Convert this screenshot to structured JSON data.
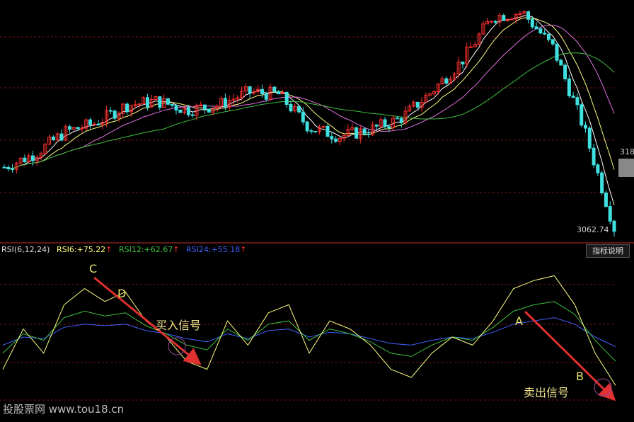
{
  "indicator": {
    "name": "RSI(6,12,24)",
    "rsi6_label": "RSI6:",
    "rsi6_value": "+75.22",
    "rsi12_label": "RSI12:",
    "rsi12_value": "+62.67",
    "rsi24_label": "RSI24:",
    "rsi24_value": "+55.18",
    "arrow": "↑"
  },
  "explain_button": "指标说明",
  "price_labels": {
    "top_right": "318",
    "low": "3062.74"
  },
  "annotations": {
    "C": "C",
    "D": "D",
    "A": "A",
    "B": "B",
    "buy": "买入信号",
    "sell": "卖出信号"
  },
  "watermark": "投股票网 www.tou18.cn",
  "colors": {
    "bg": "#000000",
    "up": "#ff3030",
    "down": "#40e0e0",
    "ma_white": "#ffffff",
    "ma_yellow": "#ffff80",
    "ma_magenta": "#e070e0",
    "ma_green": "#40c040",
    "rsi6": "#ffff80",
    "rsi12": "#40c040",
    "rsi24": "#4060ff",
    "signal_arrow": "#e03030"
  },
  "chart_data": [
    {
      "type": "candlestick",
      "title": "",
      "series": [
        {
          "name": "price",
          "close_trend": [
            3200,
            3230,
            3280,
            3300,
            3340,
            3350,
            3330,
            3340,
            3370,
            3365,
            3290,
            3270,
            3285,
            3310,
            3370,
            3440,
            3540,
            3550,
            3470,
            3290,
            3062.74
          ]
        }
      ]
    },
    {
      "type": "line",
      "title": "RSI(6,12,24)",
      "series": [
        {
          "name": "RSI6",
          "last": 75.22,
          "values": [
            30,
            55,
            40,
            70,
            80,
            72,
            78,
            60,
            50,
            35,
            30,
            60,
            45,
            65,
            70,
            40,
            60,
            55,
            45,
            30,
            25,
            40,
            50,
            45,
            60,
            80,
            85,
            88,
            70,
            40,
            20
          ]
        },
        {
          "name": "RSI12",
          "last": 62.67,
          "values": [
            40,
            52,
            48,
            62,
            66,
            63,
            65,
            57,
            52,
            45,
            42,
            55,
            48,
            58,
            60,
            48,
            55,
            52,
            47,
            40,
            38,
            45,
            50,
            48,
            56,
            66,
            70,
            72,
            64,
            48,
            35
          ]
        },
        {
          "name": "RSI24",
          "last": 55.18,
          "values": [
            45,
            50,
            49,
            56,
            58,
            57,
            58,
            54,
            52,
            49,
            47,
            52,
            49,
            54,
            55,
            50,
            53,
            52,
            49,
            46,
            45,
            48,
            50,
            49,
            53,
            58,
            60,
            62,
            58,
            50,
            44
          ]
        }
      ]
    }
  ]
}
